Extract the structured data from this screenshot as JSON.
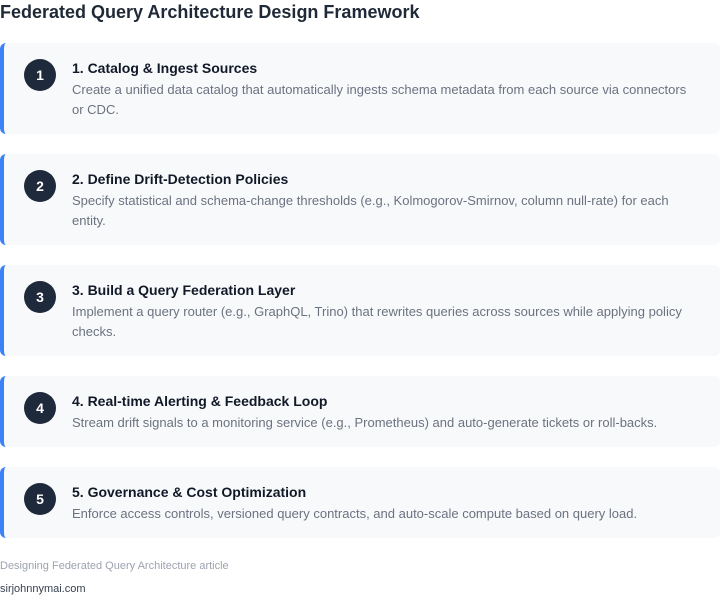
{
  "title": "Federated Query Architecture Design Framework",
  "steps": [
    {
      "number": "1",
      "title": "1. Catalog & Ingest Sources",
      "description": "Create a unified data catalog that automatically ingests schema metadata from each source via connectors or CDC."
    },
    {
      "number": "2",
      "title": "2. Define Drift-Detection Policies",
      "description": "Specify statistical and schema-change thresholds (e.g., Kolmogorov-Smirnov, column null-rate) for each entity."
    },
    {
      "number": "3",
      "title": "3. Build a Query Federation Layer",
      "description": "Implement a query router (e.g., GraphQL, Trino) that rewrites queries across sources while applying policy checks."
    },
    {
      "number": "4",
      "title": "4. Real-time Alerting & Feedback Loop",
      "description": "Stream drift signals to a monitoring service (e.g., Prometheus) and auto-generate tickets or roll-backs."
    },
    {
      "number": "5",
      "title": "5. Governance & Cost Optimization",
      "description": "Enforce access controls, versioned query contracts, and auto-scale compute based on query load."
    }
  ],
  "footer": {
    "source": "Designing Federated Query Architecture article",
    "domain": "sirjohnnymai.com"
  },
  "colors": {
    "accent": "#3b82f6",
    "badge": "#1e293b",
    "card_background": "#f8f9fb"
  }
}
